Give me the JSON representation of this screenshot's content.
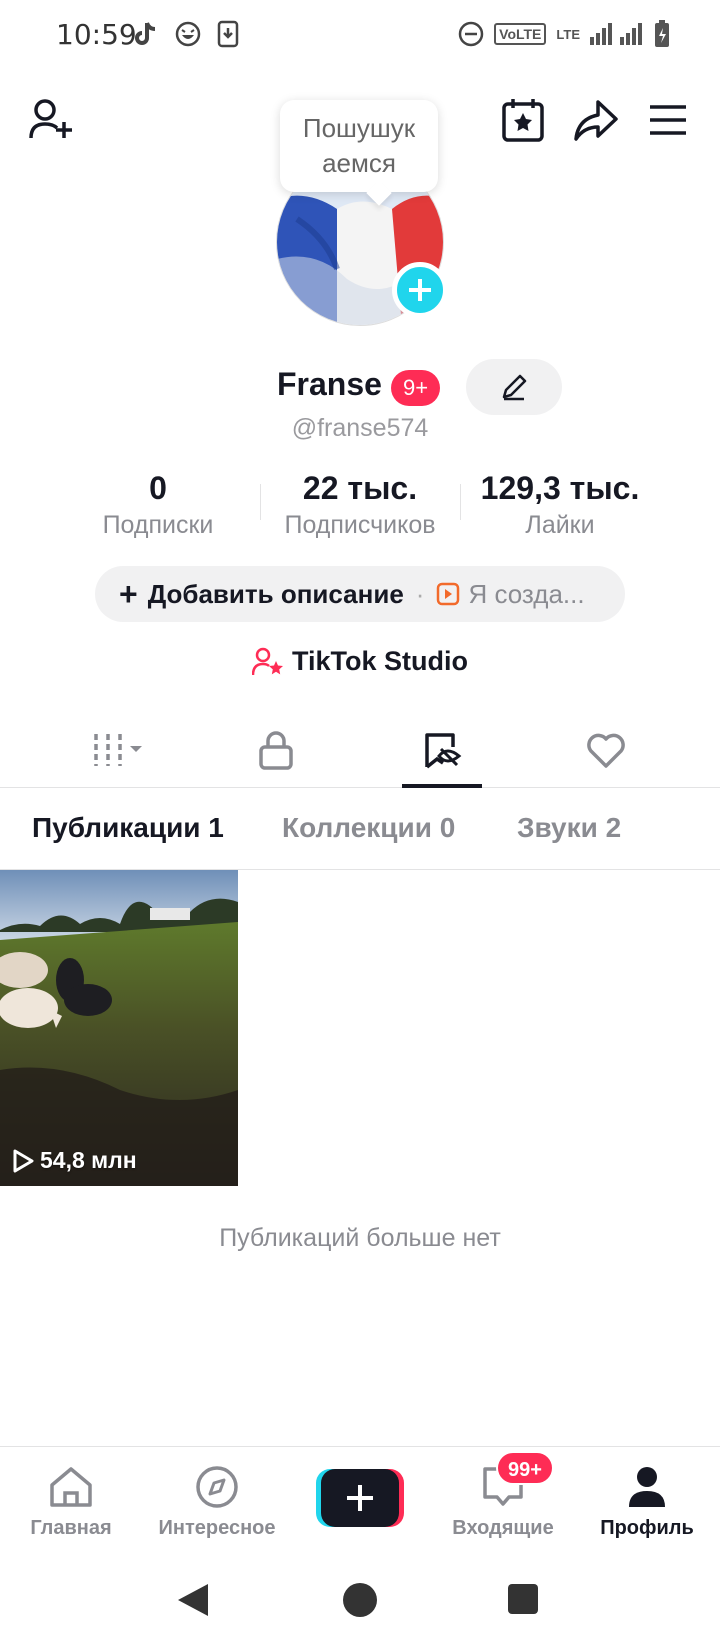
{
  "status_bar": {
    "time": "10:59",
    "network_a": "VoLTE",
    "network_b": "LTE"
  },
  "header": {
    "add_friend_icon": "add-person-icon",
    "calendar_icon": "calendar-star-icon",
    "share_icon": "share-arrow-icon",
    "menu_icon": "hamburger-menu-icon"
  },
  "profile": {
    "tooltip_line1": "Пошушук",
    "tooltip_line2": "аемся",
    "display_name": "Franse",
    "name_badge": "9+",
    "username": "@franse574",
    "stats": [
      {
        "value": "0",
        "label": "Подписки"
      },
      {
        "value": "22 тыс.",
        "label": "Подписчиков"
      },
      {
        "value": "129,3 тыс.",
        "label": "Лайки"
      }
    ],
    "add_description": "Добавить описание",
    "separator": "·",
    "creator_text": "Я созда...",
    "studio_label": "TikTok Studio"
  },
  "content_tabs": {
    "items": [
      "Публикации 1",
      "Коллекции 0",
      "Звуки 2"
    ],
    "active_index": 0
  },
  "videos": [
    {
      "views": "54,8 млн"
    }
  ],
  "empty_text": "Публикаций больше нет",
  "bottom_nav": {
    "items": [
      {
        "label": "Главная",
        "icon": "home-icon"
      },
      {
        "label": "Интересное",
        "icon": "compass-icon"
      },
      {
        "label": "Входящие",
        "icon": "inbox-icon"
      },
      {
        "label": "Профиль",
        "icon": "profile-icon"
      }
    ],
    "inbox_badge": "99+",
    "active": "Профиль"
  },
  "colors": {
    "accent_pink": "#fe2c55",
    "accent_cyan": "#20d5ec",
    "text_primary": "#161823",
    "text_secondary": "#8a8b91"
  }
}
